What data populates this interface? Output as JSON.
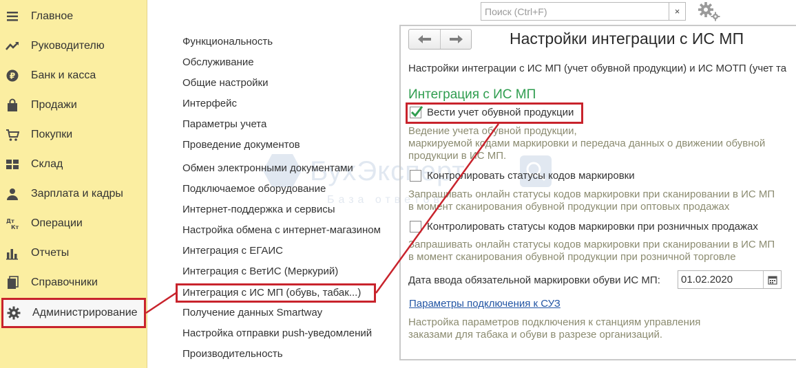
{
  "sidebar": {
    "items": [
      {
        "label": "Главное",
        "icon": "menu-lines-icon"
      },
      {
        "label": "Руководителю",
        "icon": "trend-up-icon"
      },
      {
        "label": "Банк и касса",
        "icon": "ruble-coin-icon"
      },
      {
        "label": "Продажи",
        "icon": "shopping-bag-icon"
      },
      {
        "label": "Покупки",
        "icon": "cart-icon"
      },
      {
        "label": "Склад",
        "icon": "warehouse-grid-icon"
      },
      {
        "label": "Зарплата и кадры",
        "icon": "person-icon"
      },
      {
        "label": "Операции",
        "icon": "debit-credit-icon"
      },
      {
        "label": "Отчеты",
        "icon": "bar-chart-icon"
      },
      {
        "label": "Справочники",
        "icon": "books-icon"
      },
      {
        "label": "Администрирование",
        "icon": "gear-icon",
        "active": true
      }
    ]
  },
  "menu": {
    "items": [
      "Функциональность",
      "Обслуживание",
      "Общие настройки",
      "Интерфейс",
      "Параметры учета",
      "Проведение документов",
      "Обмен электронными документами",
      "Подключаемое оборудование",
      "Интернет-поддержка и сервисы",
      "Настройка обмена с интернет-магазином",
      "Интеграция с ЕГАИС",
      "Интеграция с ВетИС (Меркурий)",
      "Интеграция с ИС МП (обувь, табак...)",
      "Получение данных Smartway",
      "Настройка отправки push-уведомлений",
      "Производительность"
    ],
    "active_index": 12
  },
  "search": {
    "placeholder": "Поиск (Ctrl+F)",
    "value": "",
    "clear_glyph": "×"
  },
  "watermark": {
    "title": "БухЭксперт",
    "subtitle": "База ответов"
  },
  "form": {
    "title": "Настройки интеграции с ИС МП",
    "description": "Настройки интеграции с ИС МП (учет обувной продукции) и ИС МОТП (учет та",
    "section_heading": "Интеграция с ИС МП",
    "options": [
      {
        "label": "Вести учет обувной продукции",
        "checked": true,
        "hint": [
          "Ведение учета обувной продукции,",
          "маркируемой кодами маркировки и передача данных о движении обувной",
          "продукции в ИС МП."
        ]
      },
      {
        "label": "Контролировать статусы кодов маркировки",
        "checked": false,
        "hint": [
          "Запрашивать онлайн статусы кодов маркировки при сканировании в ИС МП",
          "в момент сканирования обувной продукции при оптовых продажах"
        ]
      },
      {
        "label": "Контролировать статусы кодов маркировки при розничных продажах",
        "checked": false,
        "hint": [
          "Запрашивать онлайн статусы кодов маркировки при сканировании в ИС МП",
          "в момент сканирования обувной продукции при розничной торговле"
        ]
      }
    ],
    "date_label": "Дата ввода обязательной маркировки обуви ИС МП:",
    "date_value": "01.02.2020",
    "link_label": "Параметры подключения к СУЗ",
    "link_hint": [
      "Настройка параметров подключения к станциям управления",
      "заказами для табака и обуви в разрезе организаций."
    ]
  },
  "colors": {
    "sidebar_bg": "#fbeea1",
    "highlight": "#c8232c",
    "section_green": "#2f9d4f",
    "link_blue": "#2255a4",
    "hint_text": "#8b8b70"
  }
}
